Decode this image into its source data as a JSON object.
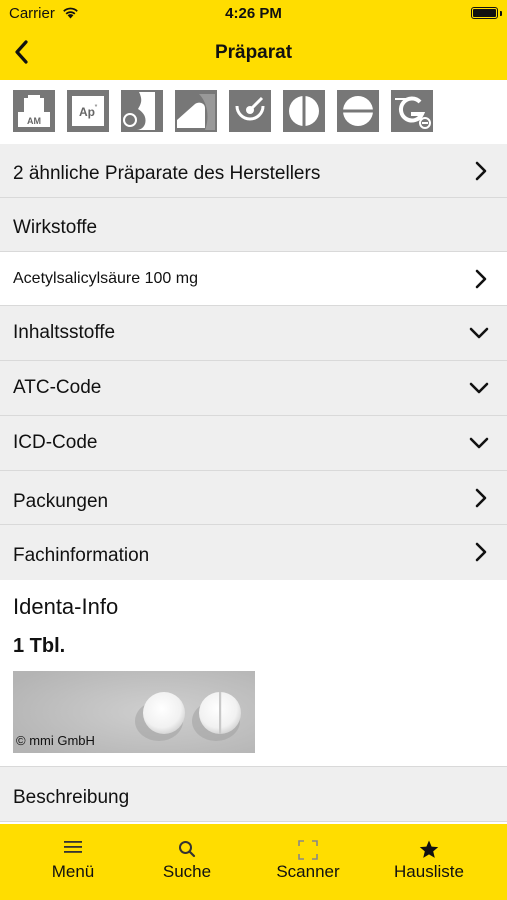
{
  "status_bar": {
    "carrier": "Carrier",
    "time": "4:26 PM"
  },
  "nav": {
    "title": "Präparat"
  },
  "icon_bar": {
    "icons": [
      "am-icon",
      "ap-icon",
      "pregnancy-icon",
      "breastfeeding-icon",
      "alcohol-icon",
      "tablet-scored-icon",
      "tablet-divisible-icon",
      "generic-icon"
    ]
  },
  "rows": {
    "similar": "2 ähnliche Präparate des Herstellers",
    "wirkstoffe": "Wirkstoffe",
    "acetyl": "Acetylsalicylsäure 100 mg",
    "inhaltsstoffe": "Inhaltsstoffe",
    "atc": "ATC-Code",
    "icd": "ICD-Code",
    "packungen": "Packungen",
    "fachinfo": "Fachinformation",
    "beschreibung": "Beschreibung"
  },
  "identa": {
    "title": "Identa-Info",
    "dose": "1 Tbl.",
    "copyright": "© mmi GmbH"
  },
  "tabbar": {
    "menu": "Menü",
    "search": "Suche",
    "scanner": "Scanner",
    "hausliste": "Hausliste"
  },
  "colors": {
    "accent": "#FFDD00",
    "row_bg": "#EFEFEF",
    "icon_bg": "#777777"
  }
}
